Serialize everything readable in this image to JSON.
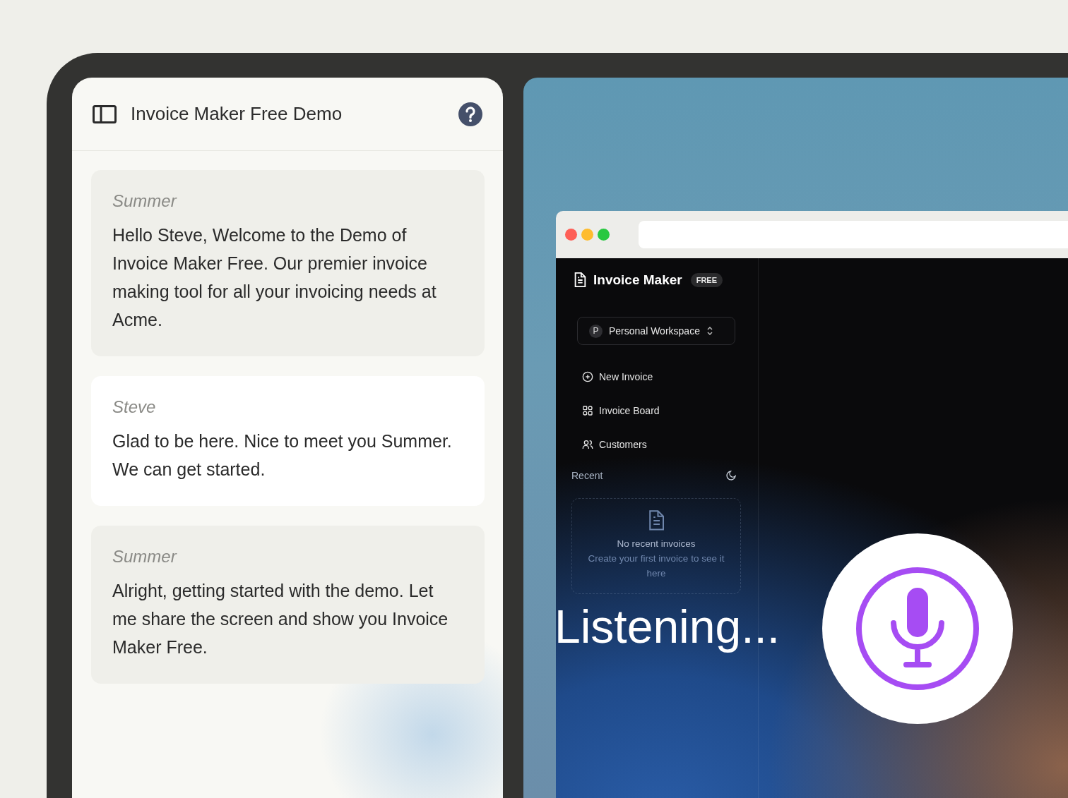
{
  "chat_panel": {
    "title": "Invoice Maker Free Demo",
    "messages": [
      {
        "kind": "agent",
        "speaker": "Summer",
        "text": "Hello Steve, Welcome to the Demo of Invoice Maker Free. Our premier invoice making tool for all your invoicing needs at Acme."
      },
      {
        "kind": "user",
        "speaker": "Steve",
        "text": "Glad to be here. Nice to meet you Summer. We can get started."
      },
      {
        "kind": "agent",
        "speaker": "Summer",
        "text": "Alright, getting started with the demo. Let me share the screen and show you Invoice Maker Free."
      }
    ]
  },
  "shared_screen": {
    "app": {
      "name": "Invoice Maker",
      "badge": "FREE",
      "workspace": {
        "initial": "P",
        "name": "Personal Workspace"
      },
      "nav": [
        {
          "kind": "new",
          "label": "New Invoice"
        },
        {
          "kind": "board",
          "label": "Invoice Board"
        },
        {
          "kind": "customers",
          "label": "Customers"
        }
      ],
      "recent": {
        "heading": "Recent",
        "empty_title": "No recent invoices",
        "empty_hint": "Create your first invoice to see it here"
      }
    },
    "status": "Listening..."
  }
}
